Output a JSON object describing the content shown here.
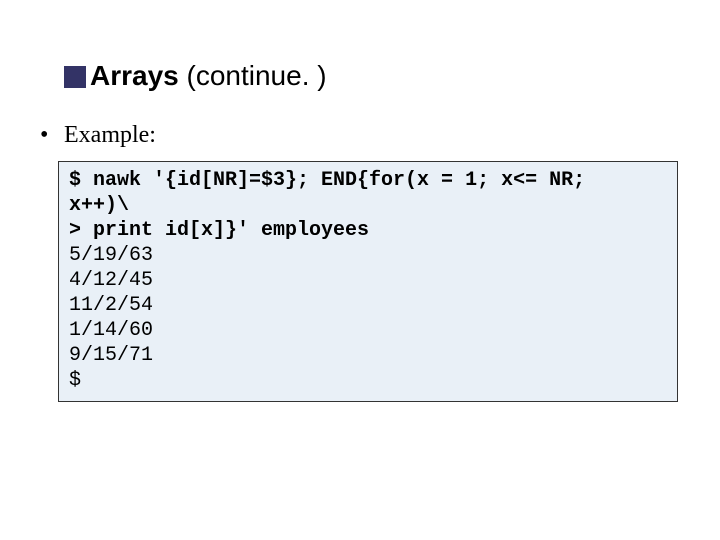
{
  "title": {
    "main": "Arrays",
    "suffix": "(continue. )"
  },
  "bullet": {
    "marker": "•",
    "label": "Example:"
  },
  "code": {
    "command_lines": [
      "$ nawk '{id[NR]=$3}; END{for(x = 1; x<= NR;",
      "x++)\\",
      "> print id[x]}' employees"
    ],
    "output_lines": [
      "5/19/63",
      "4/12/45",
      "11/2/54",
      "1/14/60",
      "9/15/71",
      "$"
    ]
  }
}
